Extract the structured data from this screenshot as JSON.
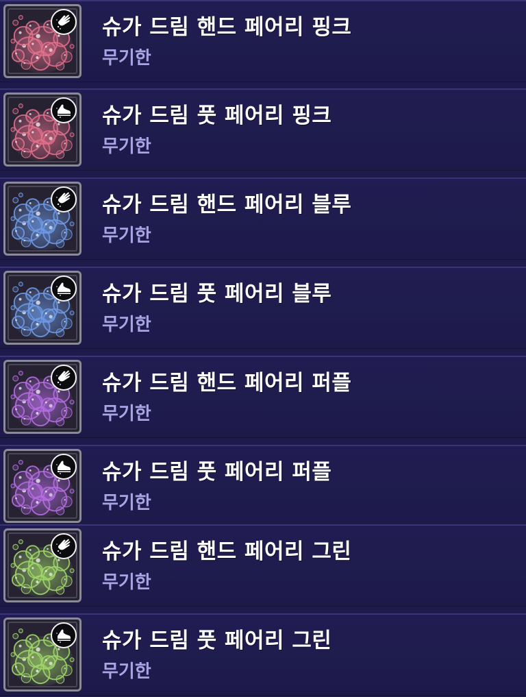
{
  "items": [
    {
      "name": "슈가 드림 핸드 페어리 핑크",
      "duration": "무기한",
      "kind": "hand-icon",
      "color": "#e0708c"
    },
    {
      "name": "슈가 드림 풋 페어리 핑크",
      "duration": "무기한",
      "kind": "foot-icon",
      "color": "#e0708c"
    },
    {
      "name": "슈가 드림 핸드 페어리 블루",
      "duration": "무기한",
      "kind": "hand-icon",
      "color": "#6f9ae6"
    },
    {
      "name": "슈가 드림 풋 페어리 블루",
      "duration": "무기한",
      "kind": "foot-icon",
      "color": "#6f9ae6"
    },
    {
      "name": "슈가 드림 핸드 페어리 퍼플",
      "duration": "무기한",
      "kind": "hand-icon",
      "color": "#b46de0"
    },
    {
      "name": "슈가 드림 풋 페어리 퍼플",
      "duration": "무기한",
      "kind": "foot-icon",
      "color": "#b46de0"
    },
    {
      "name": "슈가 드림 핸드 페어리 그린",
      "duration": "무기한",
      "kind": "hand-icon",
      "color": "#9fd46a"
    },
    {
      "name": "슈가 드림 풋 페어리 그린",
      "duration": "무기한",
      "kind": "foot-icon",
      "color": "#9fd46a"
    }
  ]
}
